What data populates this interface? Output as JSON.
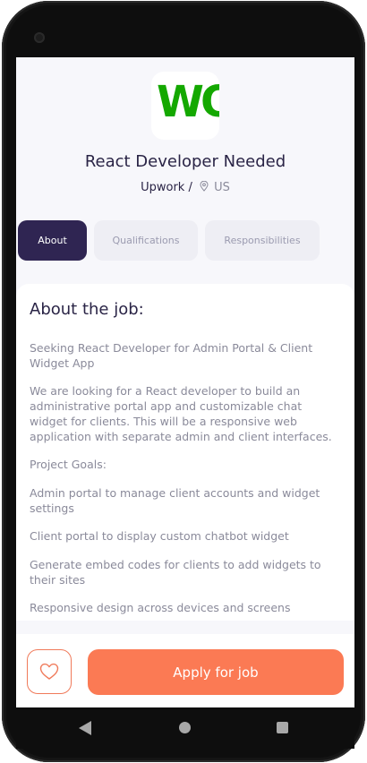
{
  "job": {
    "logo_text": "WO",
    "title": "React Developer Needed",
    "company": "Upwork /",
    "location": "US"
  },
  "tabs": [
    {
      "label": "About",
      "active": true
    },
    {
      "label": "Qualifications",
      "active": false
    },
    {
      "label": "Responsibilities",
      "active": false
    }
  ],
  "about": {
    "heading": "About the job:",
    "paragraphs": [
      "Seeking React Developer for Admin Portal & Client Widget App",
      "We are looking for a React developer to build an administrative portal app and customizable chat widget for clients. This will be a responsive web application with separate admin and client interfaces.",
      "Project Goals:",
      "Admin portal to manage client accounts and widget settings",
      "Client portal to display custom chatbot widget",
      "Generate embed codes for clients to add widgets to their sites",
      "Responsive design across devices and screens"
    ]
  },
  "actions": {
    "favorite_icon": "heart-icon",
    "apply_label": "Apply for job"
  },
  "colors": {
    "accent": "#fb7a54",
    "active_tab": "#2f2552",
    "brand_green": "#14a800"
  },
  "navbar_icons": [
    "back-icon",
    "home-icon",
    "recents-icon"
  ]
}
